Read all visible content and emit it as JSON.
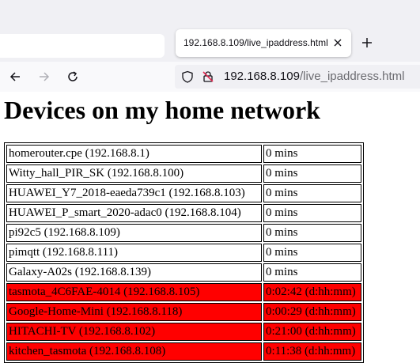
{
  "browser": {
    "tab": {
      "title": "192.168.8.109/live_ipaddress.html"
    },
    "url": {
      "host": "192.168.8.109",
      "path": "/live_ipaddress.html"
    }
  },
  "page": {
    "title": "Devices on my home network"
  },
  "devices": [
    {
      "name": "homerouter.cpe (192.168.8.1)",
      "last_seen": "0 mins",
      "status": "online"
    },
    {
      "name": "Witty_hall_PIR_SK (192.168.8.100)",
      "last_seen": "0 mins",
      "status": "online"
    },
    {
      "name": "HUAWEI_Y7_2018-eaeda739c1 (192.168.8.103)",
      "last_seen": "0 mins",
      "status": "online"
    },
    {
      "name": "HUAWEI_P_smart_2020-adac0 (192.168.8.104)",
      "last_seen": "0 mins",
      "status": "online"
    },
    {
      "name": "pi92c5 (192.168.8.109)",
      "last_seen": "0 mins",
      "status": "online"
    },
    {
      "name": "pimqtt (192.168.8.111)",
      "last_seen": "0 mins",
      "status": "online"
    },
    {
      "name": "Galaxy-A02s (192.168.8.139)",
      "last_seen": "0 mins",
      "status": "online"
    },
    {
      "name": "tasmota_4C6FAE-4014 (192.168.8.105)",
      "last_seen": "0:02:42 (d:hh:mm)",
      "status": "offline"
    },
    {
      "name": "Google-Home-Mini (192.168.8.118)",
      "last_seen": "0:00:29 (d:hh:mm)",
      "status": "offline"
    },
    {
      "name": "HITACHI-TV (192.168.8.102)",
      "last_seen": "0:21:00 (d:hh:mm)",
      "status": "offline"
    },
    {
      "name": "kitchen_tasmota (192.168.8.108)",
      "last_seen": "0:11:38 (d:hh:mm)",
      "status": "offline"
    }
  ],
  "colors": {
    "offline_row": "#ff0000",
    "online_row": "#ffffff"
  },
  "icons": [
    "close-icon",
    "plus-icon",
    "back-arrow-icon",
    "forward-arrow-icon",
    "reload-icon",
    "shield-icon",
    "insecure-lock-icon"
  ]
}
